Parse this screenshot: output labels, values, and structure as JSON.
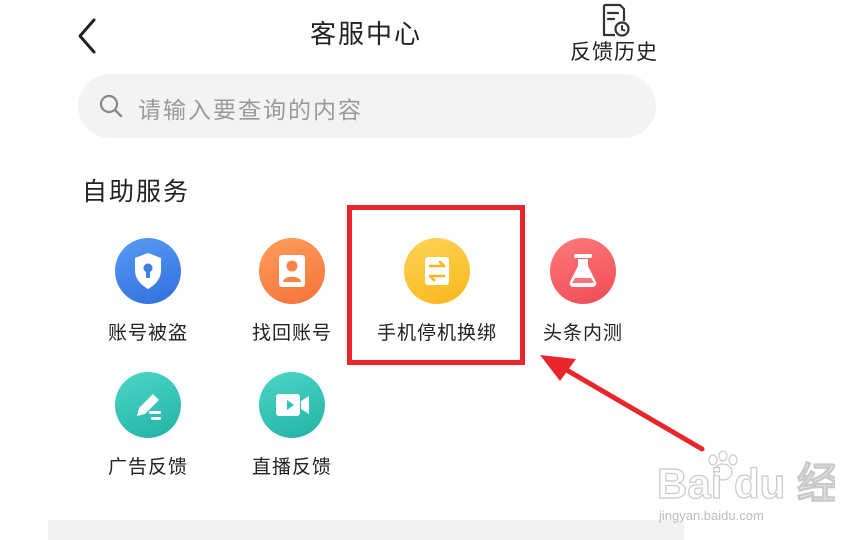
{
  "header": {
    "title": "客服中心",
    "history_label": "反馈历史"
  },
  "search": {
    "placeholder": "请输入要查询的内容"
  },
  "section": {
    "title": "自助服务"
  },
  "services": [
    {
      "label": "账号被盗",
      "icon": "shield-lock-icon",
      "color": "#3f7fe8"
    },
    {
      "label": "找回账号",
      "icon": "user-id-icon",
      "color": "#f7824a"
    },
    {
      "label": "手机停机换绑",
      "icon": "swap-arrows-icon",
      "color": "#fbc232"
    },
    {
      "label": "头条内测",
      "icon": "flask-icon",
      "color": "#f35e66"
    },
    {
      "label": "广告反馈",
      "icon": "edit-pen-icon",
      "color": "#2fc3b5"
    },
    {
      "label": "直播反馈",
      "icon": "video-camera-icon",
      "color": "#2fc3b5"
    }
  ],
  "annotation": {
    "highlight_color": "#e8262b",
    "highlighted_item": "手机停机换绑"
  },
  "watermark": {
    "brand": "Bai du 经验",
    "url": "jingyan.baidu.com"
  }
}
